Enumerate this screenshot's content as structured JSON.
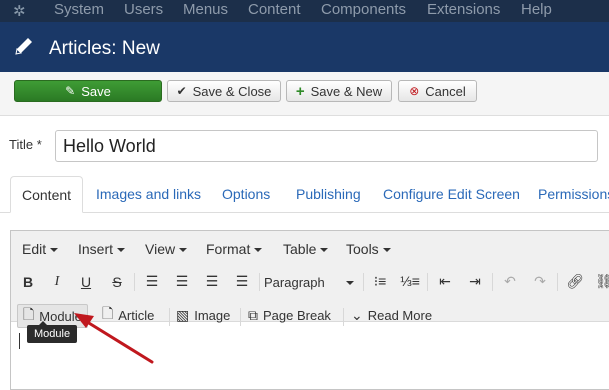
{
  "menubar": {
    "items": [
      "System",
      "Users",
      "Menus",
      "Content",
      "Components",
      "Extensions",
      "Help"
    ]
  },
  "titlebar": {
    "title": "Articles: New"
  },
  "toolbar": {
    "save": "Save",
    "save_close": "Save & Close",
    "save_new": "Save & New",
    "cancel": "Cancel"
  },
  "form": {
    "title_label": "Title *",
    "title_value": "Hello World"
  },
  "tabs": [
    "Content",
    "Images and links",
    "Options",
    "Publishing",
    "Configure Edit Screen",
    "Permissions"
  ],
  "editor": {
    "menus": [
      "Edit",
      "Insert",
      "View",
      "Format",
      "Table",
      "Tools"
    ],
    "format_select": "Paragraph",
    "extra_buttons": [
      "Module",
      "Article",
      "Image",
      "Page Break",
      "Read More"
    ],
    "tooltip": "Module"
  },
  "colors": {
    "menubar_bg": "#1c2f4a",
    "titlebar_bg": "#1a3867",
    "save_green": "#2f8a28",
    "link_blue": "#2a69b8",
    "annotation_red": "#c0181e"
  }
}
